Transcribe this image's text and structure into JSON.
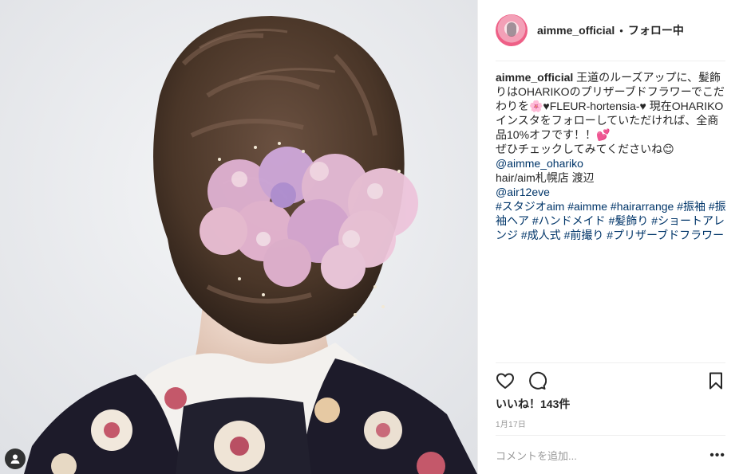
{
  "post": {
    "photo_alt": "",
    "icons": {
      "user_tag": "user-tag-icon",
      "like": "heart-icon",
      "comment": "comment-bubble-icon",
      "save": "bookmark-icon",
      "more": "more-options-icon"
    }
  },
  "header": {
    "username": "aimme_official",
    "separator": "•",
    "follow_state": "フォロー中"
  },
  "caption": {
    "username": "aimme_official",
    "line1": " 王道のルーズアップに、髪飾りはOHARIKOのプリザーブドフラワーでこだわりを🌸♥FLEUR-hortensia-♥ 現在OHARIKOインスタをフォローしていただければ、全商品10%オフです！！💕",
    "line2": "ぜひチェックしてみてくださいね😊",
    "mention1": "@aimme_ohariko",
    "line3": "hair/aim札幌店 渡辺",
    "mention2": "@air12eve",
    "tags": "#スタジオaim #aimme #hairarrange #振袖 #振袖ヘア #ハンドメイド #髪飾り #ショートアレンジ #成人式 #前撮り #プリザーブドフラワー"
  },
  "likes_text": "いいね！143件",
  "date_text": "1月17日",
  "comment": {
    "placeholder": "コメントを追加...",
    "value": "",
    "more_label": "•••"
  },
  "colors": {
    "link": "#003569",
    "text": "#262626",
    "muted": "#999999",
    "divider": "#efefef"
  }
}
